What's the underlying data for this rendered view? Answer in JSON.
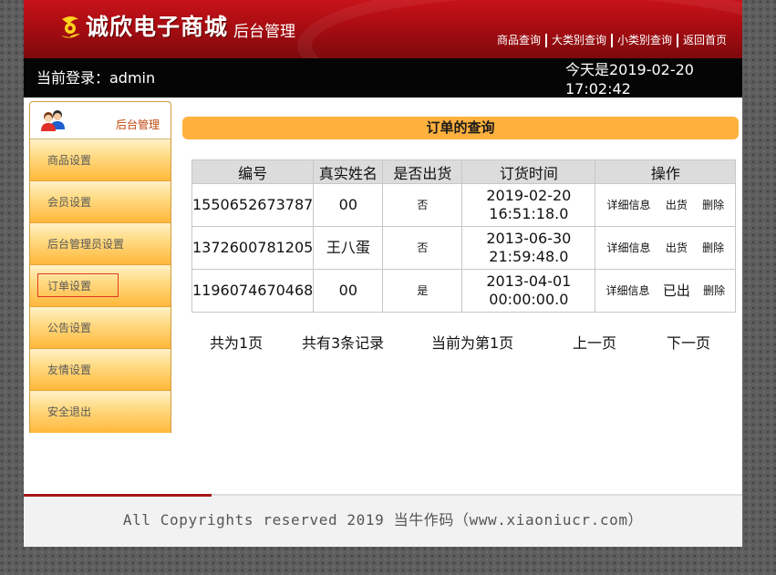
{
  "header": {
    "logo_text": "诚欣电子商城",
    "logo_subtitle": "后台管理",
    "nav": [
      {
        "label": "商品查询"
      },
      {
        "label": "大类别查询"
      },
      {
        "label": "小类别查询"
      },
      {
        "label": "返回首页"
      }
    ]
  },
  "status": {
    "current_user": "当前登录：admin",
    "today_date": "今天是2019-02-20",
    "today_time": "17:02:42"
  },
  "sidebar": {
    "title": "后台管理",
    "items": [
      {
        "label": "商品设置"
      },
      {
        "label": "会员设置"
      },
      {
        "label": "后台管理员设置"
      },
      {
        "label": "订单设置",
        "active": true
      },
      {
        "label": "公告设置"
      },
      {
        "label": "友情设置"
      },
      {
        "label": "安全退出"
      }
    ]
  },
  "main": {
    "title": "订单的查询",
    "table": {
      "headers": [
        "编号",
        "真实姓名",
        "是否出货",
        "订货时间",
        "操作"
      ],
      "rows": [
        {
          "id": "1550652673787",
          "name": "00",
          "shipped": "否",
          "date": "2019-02-20",
          "time": "16:51:18.0",
          "op_detail": "详细信息",
          "op_ship": "出货",
          "op_delete": "删除"
        },
        {
          "id": "1372600781205",
          "name": "王八蛋",
          "shipped": "否",
          "date": "2013-06-30",
          "time": "21:59:48.0",
          "op_detail": "详细信息",
          "op_ship": "出货",
          "op_delete": "删除"
        },
        {
          "id": "1196074670468",
          "name": "00",
          "shipped": "是",
          "date": "2013-04-01",
          "time": "00:00:00.0",
          "op_detail": "详细信息",
          "op_ship": "已出",
          "op_delete": "删除"
        }
      ]
    },
    "pager": {
      "total_pages": "共为1页",
      "total_records": "共有3条记录",
      "current_page": "当前为第1页",
      "prev": "上一页",
      "next": "下一页"
    }
  },
  "footer": {
    "copyright": "All Copyrights reserved 2019 当牛作码（www.xiaoniucr.com）"
  },
  "colors": {
    "header_red": "#a90c12",
    "accent_orange": "#ffb13e",
    "sidebar_orange": "#ffb83a",
    "active_box_red": "#e23a24",
    "status_black": "#050505"
  },
  "icons": {
    "logo": "logo-mark-icon",
    "sidebar_head": "admin-users-icon"
  }
}
